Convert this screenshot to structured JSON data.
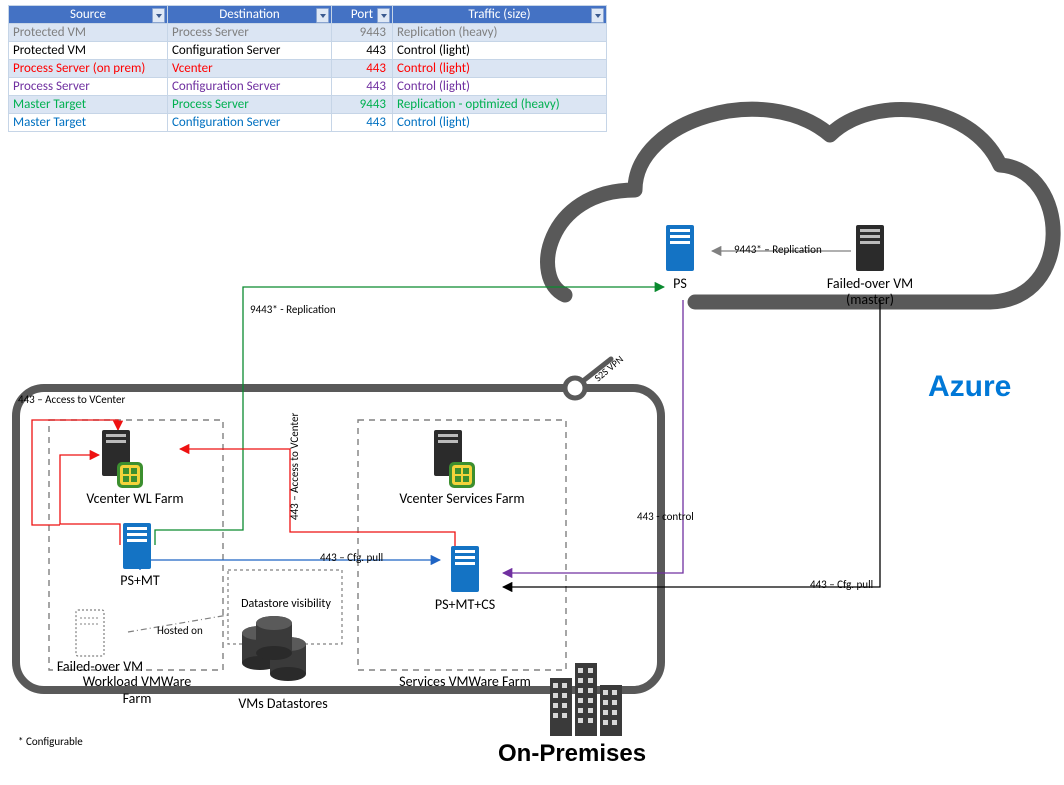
{
  "table": {
    "headers": [
      "Source",
      "Destination",
      "Port",
      "Traffic (size)"
    ],
    "rows": [
      {
        "color": "#7f7f7f",
        "band": true,
        "source": "Protected VM",
        "dest": "Process Server",
        "port": "9443",
        "traffic": "Replication (heavy)"
      },
      {
        "color": "#000000",
        "band": false,
        "source": "Protected VM",
        "dest": "Configuration Server",
        "port": "443",
        "traffic": "Control (light)"
      },
      {
        "color": "#ff0000",
        "band": true,
        "source": "Process Server (on prem)",
        "dest": "Vcenter",
        "port": "443",
        "traffic": "Control (light)"
      },
      {
        "color": "#7030a0",
        "band": false,
        "source": "Process Server",
        "dest": "Configuration Server",
        "port": "443",
        "traffic": "Control (light)"
      },
      {
        "color": "#00b050",
        "band": true,
        "source": "Master Target",
        "dest": "Process Server",
        "port": "9443",
        "traffic": "Replication - optimized (heavy)"
      },
      {
        "color": "#0070c0",
        "band": false,
        "source": "Master Target",
        "dest": "Configuration Server",
        "port": "443",
        "traffic": "Control (light)"
      }
    ]
  },
  "titles": {
    "azure": "Azure",
    "onprem": "On-Premises"
  },
  "nodes": {
    "azure_ps": "PS",
    "azure_vm1": "Failed-over VM",
    "azure_vm2": "(master)",
    "vcenter_wl": "Vcenter WL Farm",
    "psmt": "PS+MT",
    "failed_vm": "Failed-over VM",
    "workload_farm1": "Workload VMWare",
    "workload_farm2": "Farm",
    "datastores": "VMs Datastores",
    "datastore_vis": "Datastore visibility",
    "hosted_on": "Hosted on",
    "vcenter_svc": "Vcenter Services Farm",
    "psmtcs": "PS+MT+CS",
    "services_farm": "Services VMWare Farm"
  },
  "edges": {
    "e443_vcenter": "443 – Access to VCenter",
    "e443_vcenter_vert": "443 – Access to VCenter",
    "e9443_repl": "9443* - Replication",
    "e443_ctrl": "443 - control",
    "e9443_repl2": "9443* – Replication",
    "e443_cfgpull_a": "443 – Cfg. pull",
    "e443_cfgpull_b": "443 – Cfg. pull",
    "s2s_vpn": "S2S VPN"
  },
  "footnote": "* Configurable"
}
